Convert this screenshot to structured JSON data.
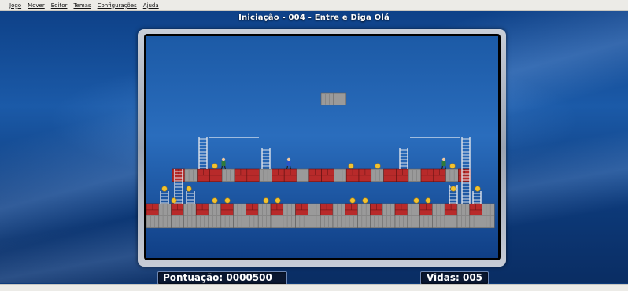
{
  "menu": {
    "items": [
      "Jogo",
      "Mover",
      "Editor",
      "Temas",
      "Configurações",
      "Ajuda"
    ]
  },
  "level": {
    "title": "Iniciação - 004 - Entre e Diga Olá"
  },
  "hud": {
    "score_label": "Pontuação: 0000500",
    "lives_label": "Vidas: 005"
  },
  "colors": {
    "background": "#0d3a7a",
    "hud_bg": "#0a1730",
    "brick_red": "#b82a2a",
    "concrete": "#9a9a9a",
    "gold": "#f2c230"
  },
  "icons": {
    "player": "runner-icon",
    "enemy": "guard-icon",
    "gold": "gold-icon",
    "ladder": "ladder-icon",
    "bar": "bar-icon"
  }
}
